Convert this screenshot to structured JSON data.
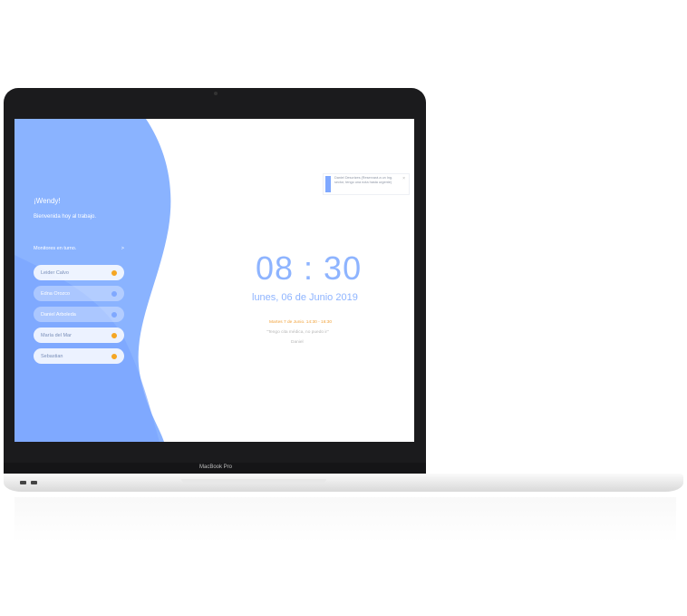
{
  "device": {
    "brand_label": "MacBook Pro"
  },
  "sidebar": {
    "greeting": "¡Wendy!",
    "welcome": "Bienvenida hoy al trabajo.",
    "monitors_title": "Monitores en turno.",
    "monitors_arrow": ">",
    "monitors": [
      {
        "name": "Leider Calvo",
        "status_color": "#f5a623",
        "active": true
      },
      {
        "name": "Edna Orozco",
        "status_color": "#7fa8ff",
        "active": false
      },
      {
        "name": "Daniel Arboleda",
        "status_color": "#7fa8ff",
        "active": false
      },
      {
        "name": "María del Mar",
        "status_color": "#f5a623",
        "active": true
      },
      {
        "name": "Sebastian",
        "status_color": "#f5a623",
        "active": true
      }
    ]
  },
  "main": {
    "time": "08 : 30",
    "date": "lunes, 06 de Junio 2019",
    "event_title": "Martes 7 de Junio. 14:30 - 16:30",
    "event_message": "\"Tengo cita médica, no puedo ir\"",
    "event_author": "Daniel"
  },
  "notification": {
    "text": "Daniel Descrizes (Reservará a un Ing. sector, tengo una nota hasta urgente)",
    "close_icon": "×"
  },
  "colors": {
    "accent": "#8eb4ff",
    "sidebar": "#7fa8ff",
    "warning": "#f5a623"
  }
}
